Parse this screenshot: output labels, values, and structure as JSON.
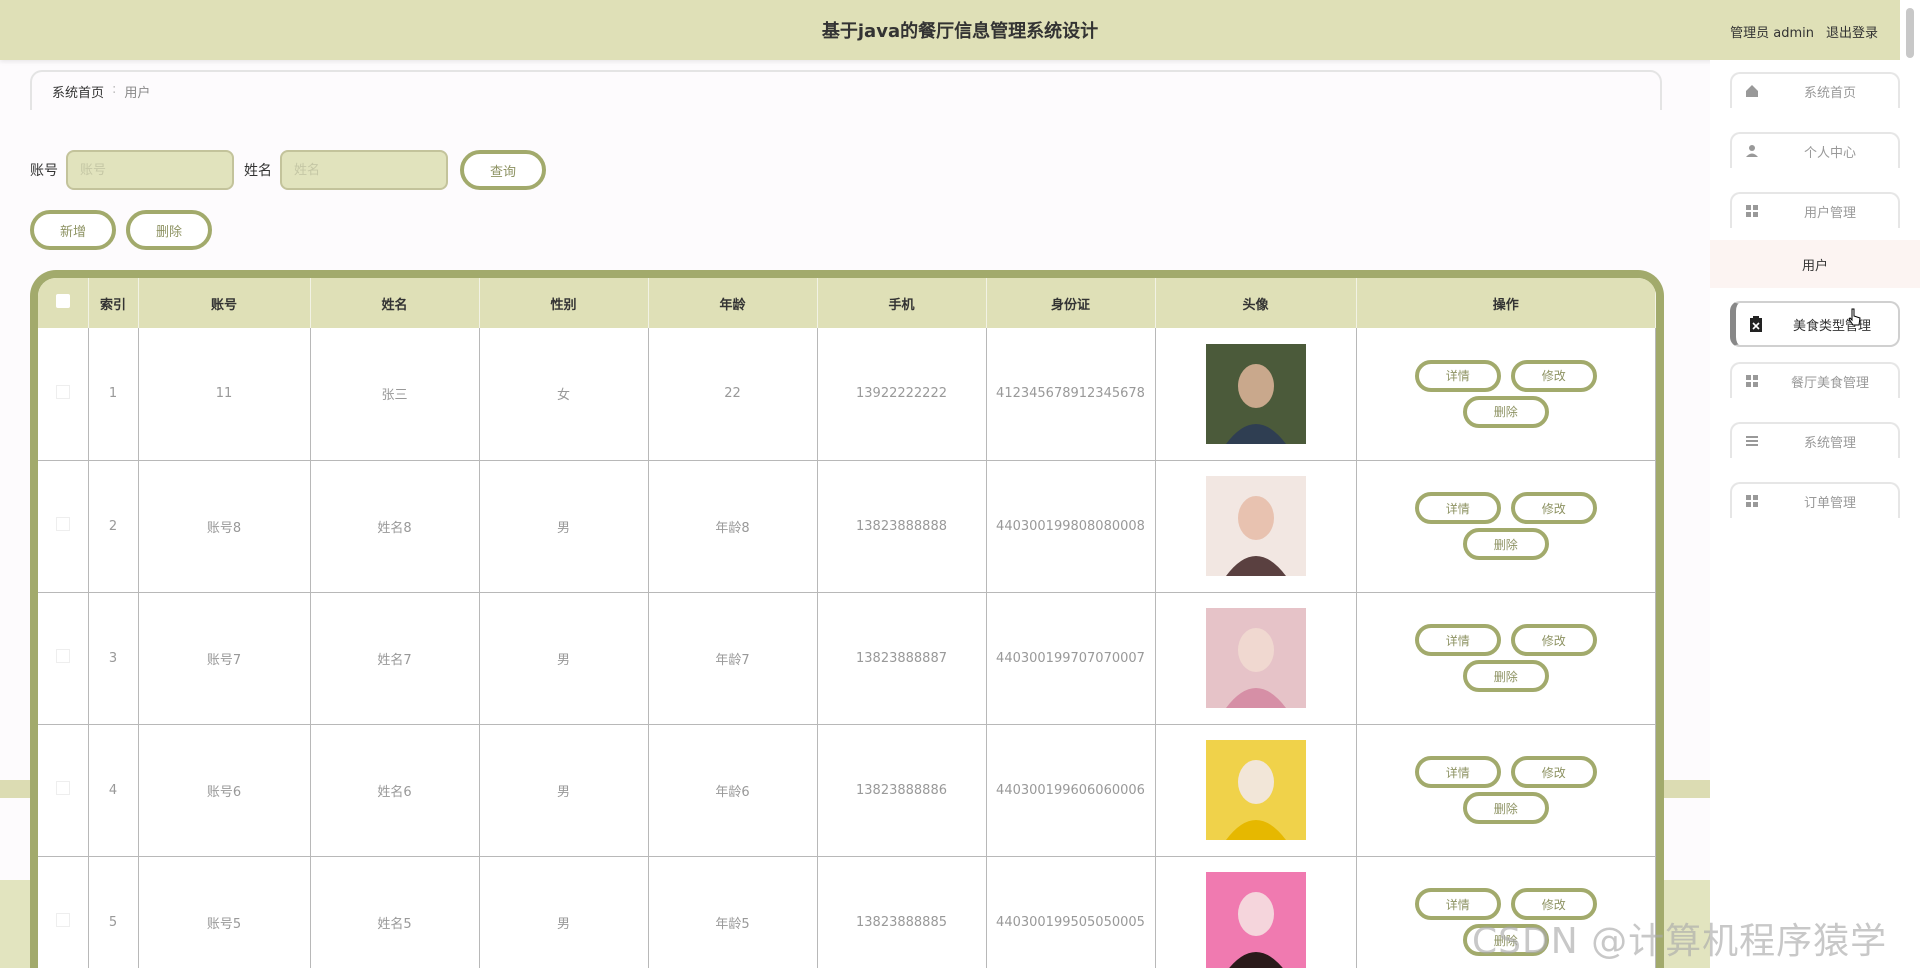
{
  "header": {
    "title": "基于java的餐厅信息管理系统设计",
    "user_label": "管理员 admin",
    "logout_label": "退出登录"
  },
  "breadcrumb": {
    "home": "系统首页",
    "separator": ":",
    "current": "用户"
  },
  "search": {
    "account_label": "账号",
    "account_placeholder": "账号",
    "name_label": "姓名",
    "name_placeholder": "姓名",
    "query_label": "查询"
  },
  "actions": {
    "add_label": "新增",
    "delete_label": "删除"
  },
  "table": {
    "headers": [
      "索引",
      "账号",
      "姓名",
      "性别",
      "年龄",
      "手机",
      "身份证",
      "头像",
      "操作"
    ],
    "rows": [
      {
        "index": "1",
        "account": "11",
        "name": "张三",
        "gender": "女",
        "age": "22",
        "phone": "13922222222",
        "id_card": "412345678912345678"
      },
      {
        "index": "2",
        "account": "账号8",
        "name": "姓名8",
        "gender": "男",
        "age": "年龄8",
        "phone": "13823888888",
        "id_card": "440300199808080008"
      },
      {
        "index": "3",
        "account": "账号7",
        "name": "姓名7",
        "gender": "男",
        "age": "年龄7",
        "phone": "13823888887",
        "id_card": "440300199707070007"
      },
      {
        "index": "4",
        "account": "账号6",
        "name": "姓名6",
        "gender": "男",
        "age": "年龄6",
        "phone": "13823888886",
        "id_card": "440300199606060006"
      },
      {
        "index": "5",
        "account": "账号5",
        "name": "姓名5",
        "gender": "男",
        "age": "年龄5",
        "phone": "13823888885",
        "id_card": "440300199505050005"
      }
    ],
    "op_detail": "详情",
    "op_edit": "修改",
    "op_delete": "删除"
  },
  "sidebar": {
    "items": [
      {
        "label": "系统首页",
        "icon": "home-icon"
      },
      {
        "label": "个人中心",
        "icon": "person-icon"
      },
      {
        "label": "用户管理",
        "icon": "grid-icon"
      },
      {
        "label": "美食类型管理",
        "icon": "clipboard-icon"
      },
      {
        "label": "餐厅美食管理",
        "icon": "grid-icon"
      },
      {
        "label": "系统管理",
        "icon": "menu-icon"
      },
      {
        "label": "订单管理",
        "icon": "grid-icon"
      }
    ],
    "sub_item": "用户"
  },
  "watermark": "CSDN @计算机程序猿学长",
  "colors": {
    "accent": "#a2aa6c",
    "header_bg": "#dfe0b7",
    "input_bg": "#e1e3bd"
  }
}
